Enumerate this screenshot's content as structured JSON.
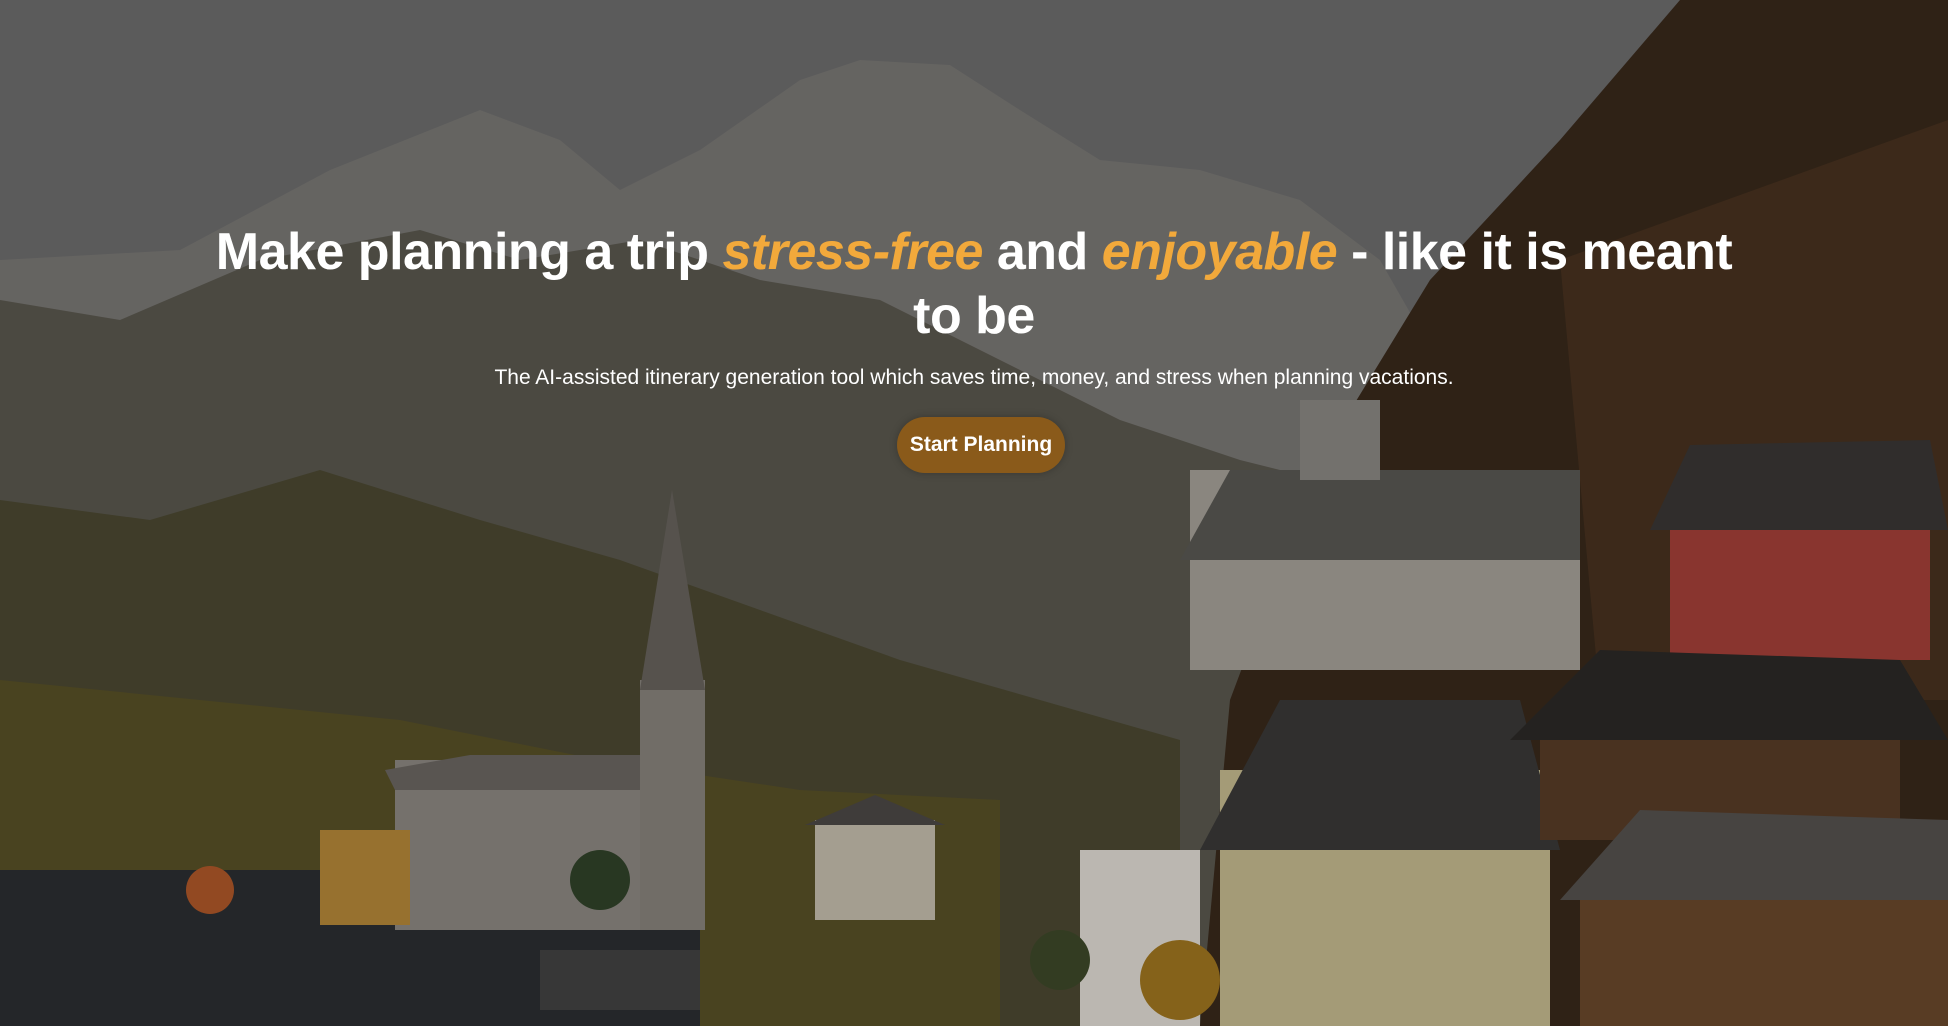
{
  "hero": {
    "headline": {
      "part1": "Make planning a trip ",
      "accent1": "stress-free",
      "part2": " and ",
      "accent2": "enjoyable",
      "part3": " - like it is meant to be"
    },
    "subtitle": "The AI-assisted itinerary generation tool which saves time, money, and stress when planning vacations.",
    "cta_label": "Start Planning"
  },
  "colors": {
    "accent": "#f2a93b",
    "button": "#8a5a1a",
    "text": "#ffffff"
  }
}
